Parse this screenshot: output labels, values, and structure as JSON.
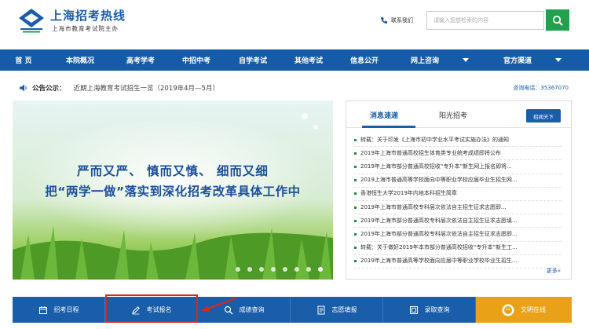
{
  "header": {
    "title": "上海招考热线",
    "subtitle": "上海市教育考试院主办",
    "contact_label": "联系我们",
    "search_placeholder": "请输入您想检索的内容"
  },
  "nav": {
    "items": [
      {
        "label": "首 页"
      },
      {
        "label": "本院概况"
      },
      {
        "label": "高考学考"
      },
      {
        "label": "中招中考"
      },
      {
        "label": "自学考试"
      },
      {
        "label": "其他考试"
      },
      {
        "label": "信息公开"
      },
      {
        "label": "网上咨询"
      },
      {
        "label": "官方渠道"
      }
    ]
  },
  "announcement": {
    "label": "公告公示：",
    "text": "近期上海教育考试招生一览（2019年4月—5月）",
    "hotline": "咨询电话：35367070"
  },
  "banner": {
    "line1": "严而又严、 慎而又慎、 细而又细",
    "line2": "把“两学一做”落实到深化招考改革具体工作中"
  },
  "news": {
    "tabs": [
      "消息速递",
      "阳光招考"
    ],
    "button": "招闻天下",
    "items": [
      "转载：关于印发《上海市初中学业水平考试实施办法》的通知",
      "2019年上海市普通高校招生体育类专业统考成绩即将公布",
      "2019年上海市部分普通高校招收“专升本”新生网上报名即将...",
      "2019上海市普通高等学校面向中等职业学校应届毕业生招生网...",
      "香港恒生大学2019年内地本科招生简章",
      "2019年上海市普通高校专科层次依法自主招生征求志愿即...",
      "2019年上海市部分普通高校专科层次依法自主招生征求志愿填...",
      "2019年上海市部分普通高校专科层次依法自主招生征求志愿即...",
      "转载：关于做好2019年本市部分普通高校招收“专升本”新生工...",
      "2019年上海市普通高等学校面向应届中等职业学校毕业生招生..."
    ],
    "more": "更多»"
  },
  "bottom_bar": {
    "items": [
      {
        "label": "招考日程",
        "icon": "calendar-icon"
      },
      {
        "label": "考试报名",
        "icon": "pencil-icon"
      },
      {
        "label": "成绩查询",
        "icon": "search-icon"
      },
      {
        "label": "志愿填报",
        "icon": "form-icon"
      },
      {
        "label": "录取查询",
        "icon": "document-icon"
      },
      {
        "label": "文明在线",
        "icon": "wenming-icon"
      }
    ]
  },
  "colors": {
    "nav_blue": "#155ba7",
    "search_green": "#22a04b",
    "orange": "#e9a117",
    "highlight_red": "#e2231a"
  }
}
